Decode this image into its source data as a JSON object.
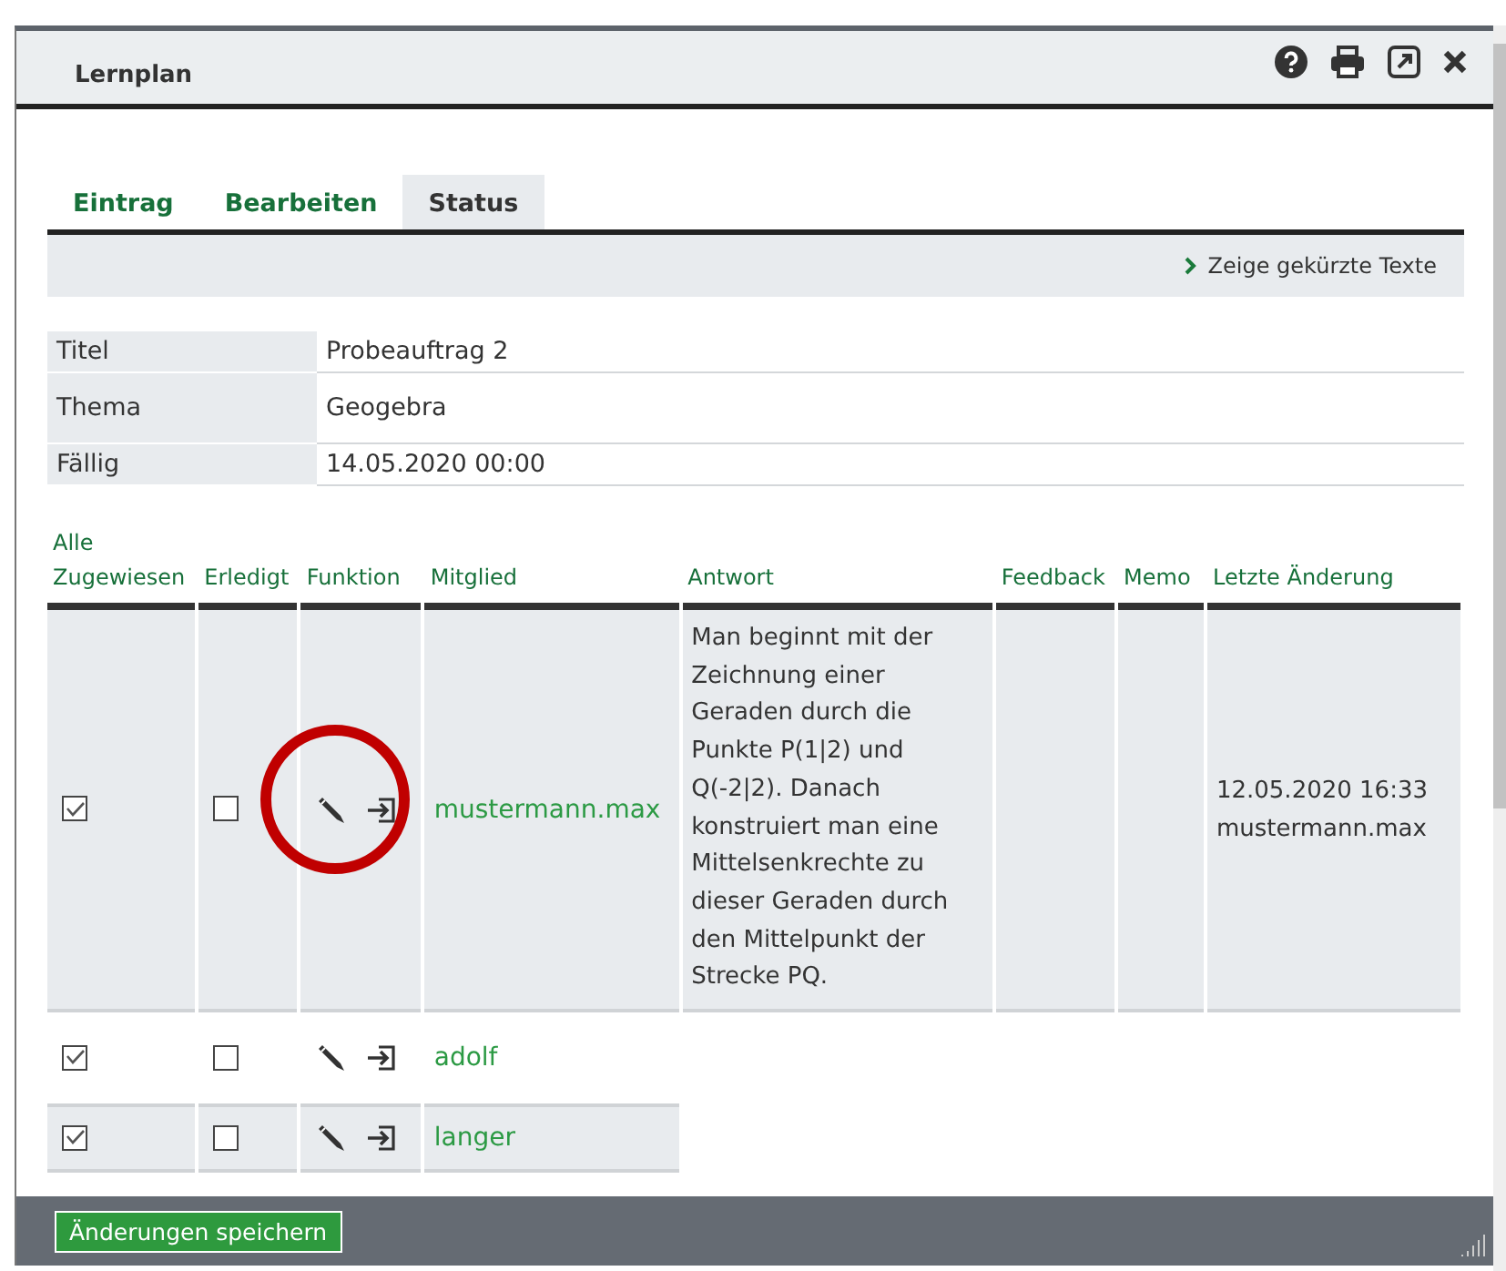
{
  "window": {
    "title": "Lernplan"
  },
  "tabs": [
    {
      "label": "Eintrag",
      "selected": false
    },
    {
      "label": "Bearbeiten",
      "selected": false
    },
    {
      "label": "Status",
      "selected": true
    }
  ],
  "toggle_link": "Zeige gekürzte Texte",
  "info": [
    {
      "label": "Titel",
      "value": "Probeauftrag 2"
    },
    {
      "label": "Thema",
      "value": "Geogebra"
    },
    {
      "label": "Fällig",
      "value": "14.05.2020 00:00"
    }
  ],
  "table": {
    "columns": [
      {
        "lines": [
          "Alle",
          "Zugewiesen"
        ]
      },
      {
        "lines": [
          "Erledigt"
        ]
      },
      {
        "lines": [
          "Funktion"
        ]
      },
      {
        "lines": [
          "Mitglied"
        ]
      },
      {
        "lines": [
          "Antwort"
        ]
      },
      {
        "lines": [
          "Feedback"
        ]
      },
      {
        "lines": [
          "Memo"
        ]
      },
      {
        "lines": [
          "Letzte Änderung"
        ]
      }
    ],
    "rows": [
      {
        "assigned": true,
        "done": false,
        "highlighted": true,
        "member": "mustermann.max",
        "answer": "Man beginnt mit der Zeichnung einer Geraden durch die Punkte P(1|2) und Q(-2|2). Danach konstruiert man eine Mittelsenkrechte zu dieser Geraden durch den Mittelpunkt der Strecke PQ.",
        "last_change": [
          "12.05.2020 16:33",
          "mustermann.max"
        ]
      },
      {
        "assigned": true,
        "done": false,
        "highlighted": false,
        "member": "adolf"
      },
      {
        "assigned": true,
        "done": false,
        "highlighted": false,
        "member": "langer"
      }
    ]
  },
  "footer": {
    "save_button": "Änderungen speichern"
  }
}
